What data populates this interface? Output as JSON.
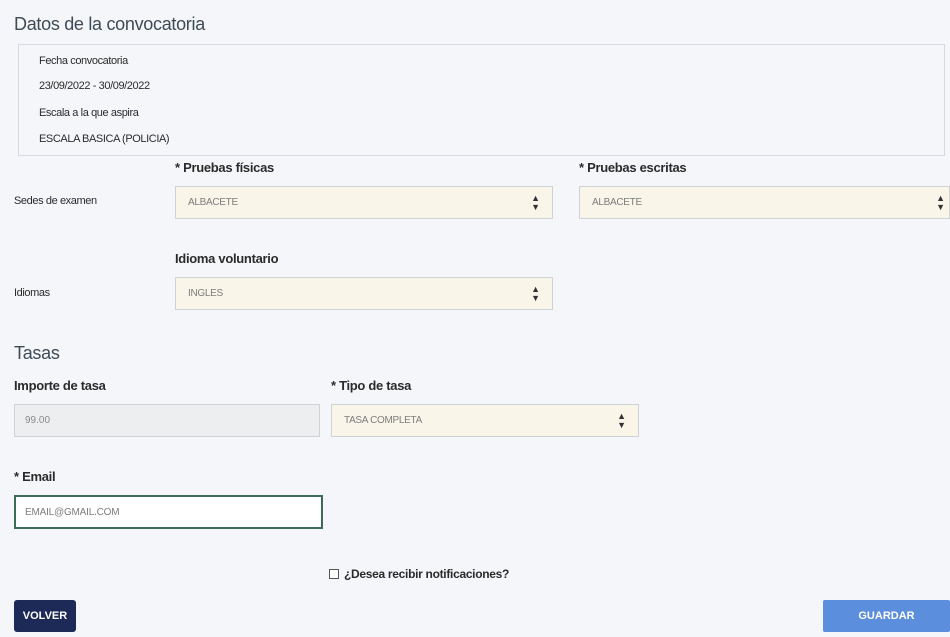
{
  "convocatoria": {
    "title": "Datos de la convocatoria",
    "fecha_label": "Fecha convocatoria",
    "fecha_value": "23/09/2022 - 30/09/2022",
    "escala_label": "Escala a la que aspira",
    "escala_value": "ESCALA BASICA (POLICIA)"
  },
  "sedes": {
    "row_label": "Sedes de examen",
    "fisicas_label": "* Pruebas físicas",
    "fisicas_value": "ALBACETE",
    "escritas_label": "* Pruebas escritas",
    "escritas_value": "ALBACETE"
  },
  "idiomas": {
    "row_label": "Idiomas",
    "voluntario_label": "Idioma voluntario",
    "voluntario_value": "INGLES"
  },
  "tasas": {
    "title": "Tasas",
    "importe_label": "Importe de tasa",
    "importe_value": "99.00",
    "tipo_label": "* Tipo de tasa",
    "tipo_value": "TASA COMPLETA"
  },
  "email": {
    "label": "* Email",
    "value": "EMAIL@GMAIL.COM"
  },
  "notificaciones": {
    "label": "¿Desea recibir notificaciones?",
    "checked": false
  },
  "actions": {
    "back_label": "VOLVER",
    "save_label": "GUARDAR"
  },
  "colors": {
    "select_bg": "#f9f5e9",
    "back_button": "#1d2a57",
    "save_button": "#5b8fde",
    "email_border": "#3b6d58"
  }
}
